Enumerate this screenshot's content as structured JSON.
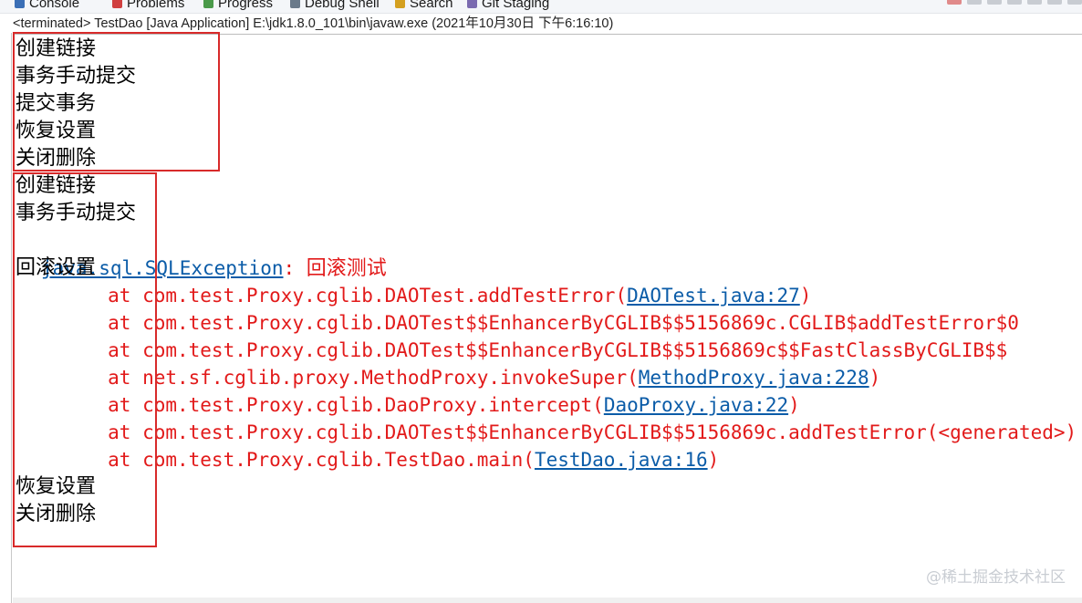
{
  "tabs": [
    {
      "label": "Console",
      "icon": "console-icon",
      "color": "#3b6fb6"
    },
    {
      "label": "Problems",
      "icon": "problems-icon",
      "color": "#d04040"
    },
    {
      "label": "Progress",
      "icon": "progress-icon",
      "color": "#4a9a4a"
    },
    {
      "label": "Debug Shell",
      "icon": "debug-shell-icon",
      "color": "#6a7a8a"
    },
    {
      "label": "Search",
      "icon": "search-icon",
      "color": "#d4a020"
    },
    {
      "label": "Git Staging",
      "icon": "git-staging-icon",
      "color": "#7a6ab0"
    }
  ],
  "status": "<terminated> TestDao [Java Application] E:\\jdk1.8.0_101\\bin\\javaw.exe (2021年10月30日 下午6:16:10)",
  "output": {
    "run1": [
      "创建链接",
      "事务手动提交",
      "提交事务",
      "恢复设置",
      "关闭删除"
    ],
    "run2": {
      "lines_before": [
        "创建链接",
        "事务手动提交"
      ],
      "exception_class": "java.sql.SQLException",
      "exception_sep": ": ",
      "exception_message": "回滚测试",
      "rollback": "回滚设置",
      "at_prefix": "        at ",
      "stack": [
        {
          "method": "com.test.Proxy.cglib.DAOTest.addTestError(",
          "source": "DAOTest.java:27",
          "suffix": ")"
        },
        {
          "method": "com.test.Proxy.cglib.DAOTest$$EnhancerByCGLIB$$5156869c.CGLIB$addTestError$0",
          "source": "",
          "suffix": ""
        },
        {
          "method": "com.test.Proxy.cglib.DAOTest$$EnhancerByCGLIB$$5156869c$$FastClassByCGLIB$$",
          "source": "",
          "suffix": ""
        },
        {
          "method": "net.sf.cglib.proxy.MethodProxy.invokeSuper(",
          "source": "MethodProxy.java:228",
          "suffix": ")"
        },
        {
          "method": "com.test.Proxy.cglib.DaoProxy.intercept(",
          "source": "DaoProxy.java:22",
          "suffix": ")"
        },
        {
          "method": "com.test.Proxy.cglib.DAOTest$$EnhancerByCGLIB$$5156869c.addTestError(<generated>)",
          "source": "",
          "suffix": ""
        },
        {
          "method": "com.test.Proxy.cglib.TestDao.main(",
          "source": "TestDao.java:16",
          "suffix": ")"
        }
      ],
      "lines_after": [
        "恢复设置",
        "关闭删除"
      ]
    }
  },
  "watermark": "@稀土掘金技术社区",
  "colors": {
    "error": "#e21a1a",
    "link": "#0b5ca8",
    "highlight_box": "#d82a2a"
  }
}
